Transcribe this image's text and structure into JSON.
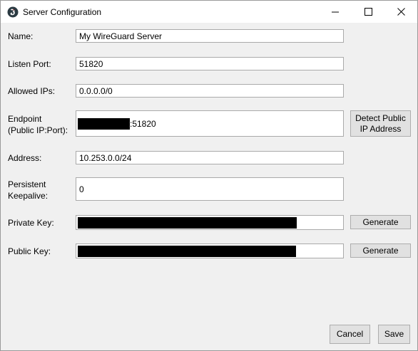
{
  "window": {
    "title": "Server Configuration",
    "minimize_glyph": "—",
    "maximize_glyph": "☐",
    "close_glyph": "✕"
  },
  "form": {
    "name": {
      "label": "Name:",
      "value": "My WireGuard Server"
    },
    "listen_port": {
      "label": "Listen Port:",
      "value": "51820"
    },
    "allowed_ips": {
      "label": "Allowed IPs:",
      "value": "0.0.0.0/0"
    },
    "endpoint": {
      "label_line1": "Endpoint",
      "label_line2": "(Public IP:Port):",
      "value_suffix": ":51820",
      "detect_button_line1": "Detect Public",
      "detect_button_line2": "IP Address"
    },
    "address": {
      "label": "Address:",
      "value": "10.253.0.0/24"
    },
    "persistent_keepalive": {
      "label_line1": "Persistent",
      "label_line2": "Keepalive:",
      "value": "0"
    },
    "private_key": {
      "label": "Private Key:",
      "generate_label": "Generate"
    },
    "public_key": {
      "label": "Public Key:",
      "generate_label": "Generate"
    }
  },
  "footer": {
    "cancel_label": "Cancel",
    "save_label": "Save"
  },
  "colors": {
    "window_bg": "#f0f0f0",
    "button_bg": "#e1e1e1",
    "field_border": "#aaaaaa",
    "redaction": "#000000"
  }
}
